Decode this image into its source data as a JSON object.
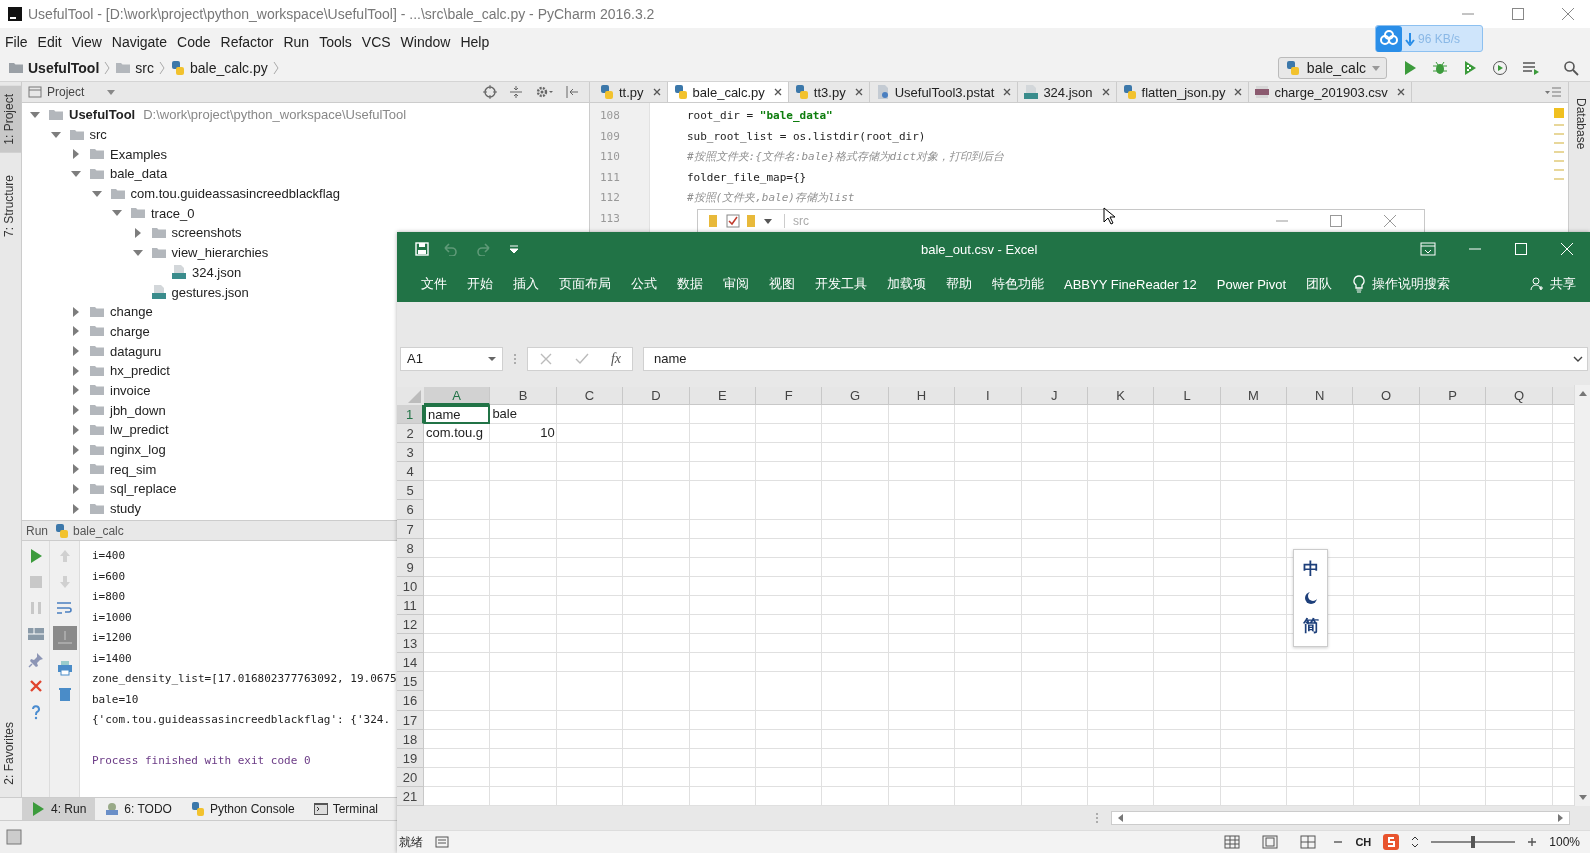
{
  "pycharm": {
    "title": "UsefulTool - [D:\\work\\project\\python_workspace\\UsefulTool] - ...\\src\\bale_calc.py - PyCharm 2016.3.2",
    "menu": [
      "File",
      "Edit",
      "View",
      "Navigate",
      "Code",
      "Refactor",
      "Run",
      "Tools",
      "VCS",
      "Window",
      "Help"
    ],
    "breadcrumbs": [
      {
        "label": "UsefulTool",
        "kind": "project"
      },
      {
        "label": "src",
        "kind": "folder"
      },
      {
        "label": "bale_calc.py",
        "kind": "python"
      }
    ],
    "run_config": "bale_calc",
    "left_tabs_top": [
      {
        "label": "1: Project",
        "selected": true
      },
      {
        "label": "7: Structure",
        "selected": false
      }
    ],
    "left_tabs_bottom": [
      {
        "label": "2: Favorites",
        "selected": false
      }
    ],
    "right_tabs": [
      {
        "label": "Database",
        "selected": false
      }
    ],
    "project_panel": {
      "title": "Project",
      "tree": [
        {
          "label": "UsefulTool",
          "path": "D:\\work\\project\\python_workspace\\UsefulTool",
          "kind": "folder",
          "expanded": true,
          "children": [
            {
              "label": "src",
              "kind": "folder",
              "expanded": true,
              "children": [
                {
                  "label": "Examples",
                  "kind": "folder",
                  "expanded": false
                },
                {
                  "label": "bale_data",
                  "kind": "folder",
                  "expanded": true,
                  "children": [
                    {
                      "label": "com.tou.guideassasincreedblackflag",
                      "kind": "folder",
                      "expanded": true,
                      "children": [
                        {
                          "label": "trace_0",
                          "kind": "folder",
                          "expanded": true,
                          "children": [
                            {
                              "label": "screenshots",
                              "kind": "folder",
                              "expanded": false
                            },
                            {
                              "label": "view_hierarchies",
                              "kind": "folder",
                              "expanded": true,
                              "children": [
                                {
                                  "label": "324.json",
                                  "kind": "json"
                                }
                              ]
                            },
                            {
                              "label": "gestures.json",
                              "kind": "json"
                            }
                          ]
                        }
                      ]
                    }
                  ]
                },
                {
                  "label": "change",
                  "kind": "folder",
                  "expanded": false
                },
                {
                  "label": "charge",
                  "kind": "folder",
                  "expanded": false
                },
                {
                  "label": "dataguru",
                  "kind": "folder",
                  "expanded": false
                },
                {
                  "label": "hx_predict",
                  "kind": "folder",
                  "expanded": false
                },
                {
                  "label": "invoice",
                  "kind": "folder",
                  "expanded": false
                },
                {
                  "label": "jbh_down",
                  "kind": "folder",
                  "expanded": false
                },
                {
                  "label": "lw_predict",
                  "kind": "folder",
                  "expanded": false
                },
                {
                  "label": "nginx_log",
                  "kind": "folder",
                  "expanded": false
                },
                {
                  "label": "req_sim",
                  "kind": "folder",
                  "expanded": false
                },
                {
                  "label": "sql_replace",
                  "kind": "folder",
                  "expanded": false
                },
                {
                  "label": "study",
                  "kind": "folder",
                  "expanded": false
                }
              ]
            }
          ]
        }
      ]
    },
    "editor": {
      "tabs": [
        {
          "label": "tt.py",
          "kind": "python",
          "selected": false
        },
        {
          "label": "bale_calc.py",
          "kind": "python",
          "selected": true
        },
        {
          "label": "tt3.py",
          "kind": "python",
          "selected": false
        },
        {
          "label": "UsefulTool3.pstat",
          "kind": "pstat",
          "selected": false
        },
        {
          "label": "324.json",
          "kind": "json",
          "selected": false
        },
        {
          "label": "flatten_json.py",
          "kind": "python",
          "selected": false
        },
        {
          "label": "charge_201903.csv",
          "kind": "csv",
          "selected": false
        }
      ],
      "lines": [
        {
          "number": "108",
          "segments": [
            {
              "text": "root_dir = ",
              "kind": "plain"
            },
            {
              "text": "\"bale_data\"",
              "kind": "string"
            }
          ]
        },
        {
          "number": "109",
          "segments": [
            {
              "text": "sub_root_list = os.listdir(root_dir)",
              "kind": "plain"
            }
          ]
        },
        {
          "number": "110",
          "segments": [
            {
              "text": "#按照文件夹:{文件名:bale}格式存储为dict对象，打印到后台",
              "kind": "comment"
            }
          ]
        },
        {
          "number": "111",
          "segments": [
            {
              "text": "folder_file_map={}",
              "kind": "plain"
            }
          ]
        },
        {
          "number": "112",
          "segments": [
            {
              "text": "#按照(文件夹,bale)存储为list",
              "kind": "comment"
            }
          ]
        },
        {
          "number": "113"
        }
      ]
    },
    "run_panel": {
      "title": "Run",
      "config": "bale_calc",
      "output": [
        {
          "text": "i=400",
          "kind": "stdout"
        },
        {
          "text": "i=600",
          "kind": "stdout"
        },
        {
          "text": "i=800",
          "kind": "stdout"
        },
        {
          "text": "i=1000",
          "kind": "stdout"
        },
        {
          "text": "i=1200",
          "kind": "stdout"
        },
        {
          "text": "i=1400",
          "kind": "stdout"
        },
        {
          "text": "zone_density_list=[17.016802377763092, 19.0675",
          "kind": "stdout"
        },
        {
          "text": "bale=10",
          "kind": "stdout"
        },
        {
          "text": "{'com.tou.guideassasincreedblackflag': {'324.",
          "kind": "stdout"
        },
        {
          "text": "Process finished with exit code 0",
          "kind": "exit"
        }
      ]
    },
    "tool_tabs": [
      {
        "label": "4: Run",
        "kind": "run",
        "selected": true
      },
      {
        "label": "6: TODO",
        "kind": "todo",
        "selected": false
      },
      {
        "label": "Python Console",
        "kind": "console",
        "selected": false
      },
      {
        "label": "Terminal",
        "kind": "terminal",
        "selected": false
      }
    ]
  },
  "speed_widget": {
    "reading": "96 KB/s"
  },
  "explorer_window": {
    "title": "src"
  },
  "excel": {
    "title": "bale_out.csv  -  Excel",
    "ribbon_tabs": [
      "文件",
      "开始",
      "插入",
      "页面布局",
      "公式",
      "数据",
      "审阅",
      "视图",
      "开发工具",
      "加载项",
      "帮助",
      "特色功能",
      "ABBYY FineReader 12",
      "Power Pivot",
      "团队"
    ],
    "tell_me": "操作说明搜索",
    "share": "共享",
    "name_box": "A1",
    "function_label": "fx",
    "formula": "name",
    "columns": [
      "A",
      "B",
      "C",
      "D",
      "E",
      "F",
      "G",
      "H",
      "I",
      "J",
      "K",
      "L",
      "M",
      "N",
      "O",
      "P",
      "Q"
    ],
    "rows": [
      {
        "header": "1",
        "cells": [
          {
            "text": "name",
            "kind": "text",
            "selected": true
          },
          {
            "text": "bale",
            "kind": "text",
            "selected": false
          }
        ]
      },
      {
        "header": "2",
        "cells": [
          {
            "text": "com.tou.g",
            "kind": "text",
            "selected": false
          },
          {
            "text": "10",
            "kind": "number",
            "selected": false
          }
        ]
      },
      {
        "header": "3"
      },
      {
        "header": "4"
      },
      {
        "header": "5"
      },
      {
        "header": "6"
      },
      {
        "header": "7"
      },
      {
        "header": "8"
      },
      {
        "header": "9"
      },
      {
        "header": "10"
      },
      {
        "header": "11"
      },
      {
        "header": "12"
      },
      {
        "header": "13"
      },
      {
        "header": "14"
      },
      {
        "header": "15"
      },
      {
        "header": "16"
      },
      {
        "header": "17"
      },
      {
        "header": "18"
      },
      {
        "header": "19"
      },
      {
        "header": "20"
      },
      {
        "header": "21"
      }
    ],
    "status": "就绪",
    "ime": "CH",
    "zoom": {
      "reading": "100%",
      "level": 0.5
    }
  },
  "ime_toolbar": {
    "mode": "中",
    "script": "简"
  }
}
